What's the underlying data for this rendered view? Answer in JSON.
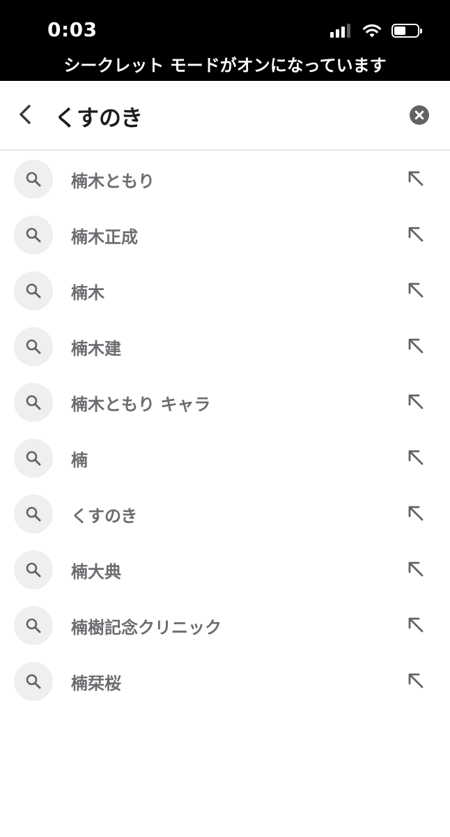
{
  "status_bar": {
    "time": "0:03",
    "signal_bars_active": 3,
    "signal_bars_total": 4,
    "battery_level": 0.5
  },
  "banner": {
    "incognito_text": "シークレット モードがオンになっています"
  },
  "search": {
    "query": "くすのき",
    "back_icon": "chevron-left-icon",
    "clear_icon": "clear-circle-icon"
  },
  "suggestions": [
    {
      "text": "楠木ともり"
    },
    {
      "text": "楠木正成"
    },
    {
      "text": "楠木"
    },
    {
      "text": "楠木建"
    },
    {
      "text": "楠木ともり キャラ"
    },
    {
      "text": "楠"
    },
    {
      "text": "くすのき"
    },
    {
      "text": "楠大典"
    },
    {
      "text": "楠樹記念クリニック"
    },
    {
      "text": "楠栞桜"
    }
  ],
  "colors": {
    "topbar_bg": "#000000",
    "suggestion_text": "#6b6b70",
    "icon_circle_bg": "#efeff2",
    "icon_gray": "#636366"
  }
}
